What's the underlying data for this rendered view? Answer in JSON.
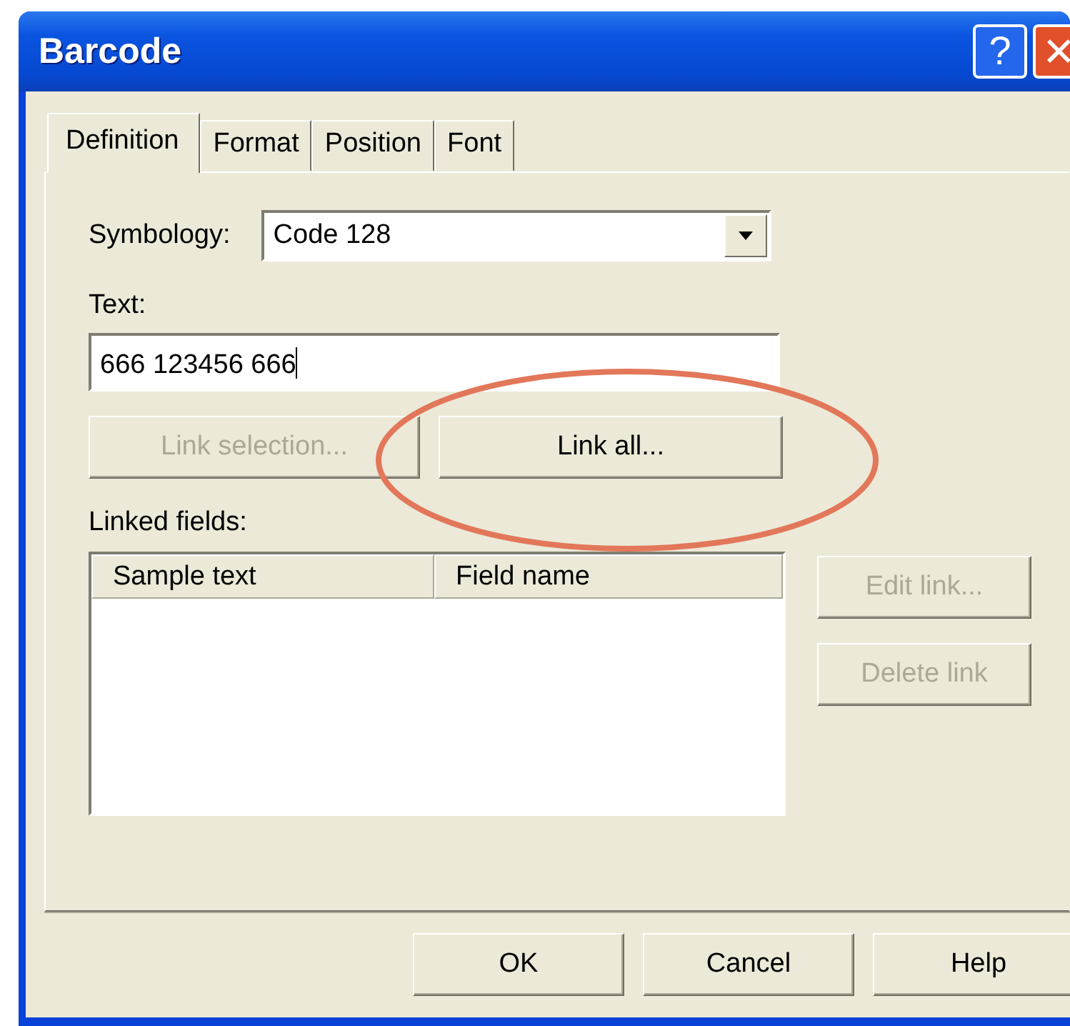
{
  "window": {
    "title": "Barcode",
    "title_buttons": [
      "?",
      "✕"
    ]
  },
  "tabs": [
    {
      "label": "Definition",
      "selected": true
    },
    {
      "label": "Format",
      "selected": false
    },
    {
      "label": "Position",
      "selected": false
    },
    {
      "label": "Font",
      "selected": false
    }
  ],
  "symbology": {
    "label": "Symbology:",
    "value": "Code 128"
  },
  "text": {
    "label": "Text:",
    "value": "666 123456 666"
  },
  "link_buttons": [
    {
      "label": "Link selection...",
      "disabled": true
    },
    {
      "label": "Link all...",
      "disabled": false
    }
  ],
  "linked_fields": {
    "label": "Linked fields:",
    "columns": [
      "Sample text",
      "Field name"
    ]
  },
  "side_buttons": [
    {
      "label": "Edit link...",
      "disabled": true
    },
    {
      "label": "Delete link",
      "disabled": true
    }
  ],
  "annotation": {
    "kind": "ellipse",
    "color": "#e2775a"
  },
  "buttons": [
    "OK",
    "Cancel",
    "Help"
  ]
}
